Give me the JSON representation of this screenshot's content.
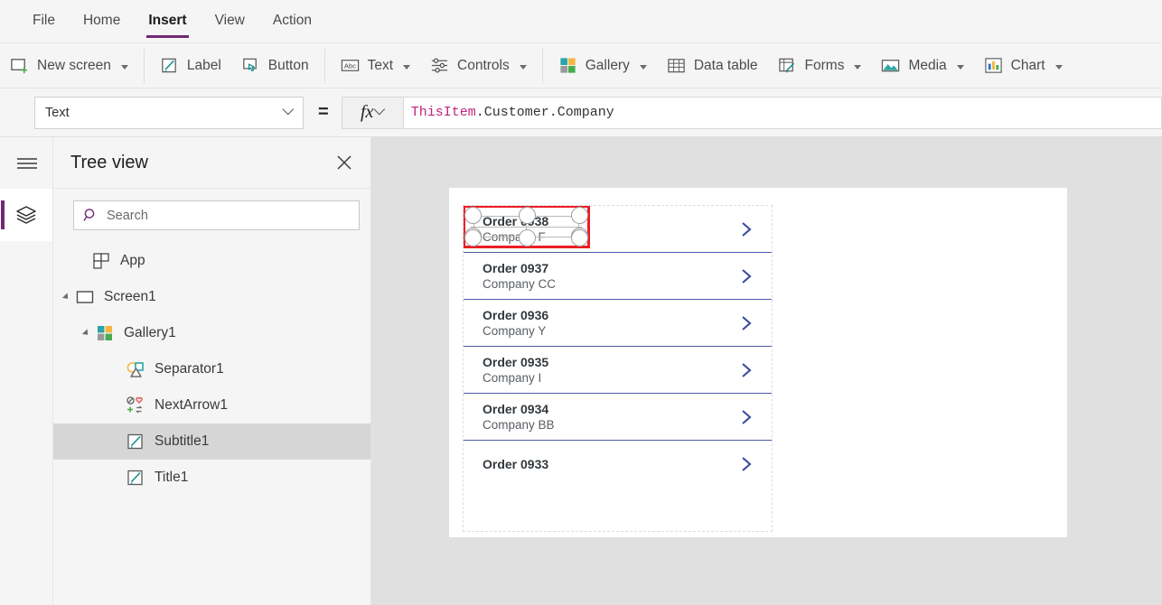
{
  "menubar": {
    "items": [
      {
        "label": "File",
        "active": false
      },
      {
        "label": "Home",
        "active": false
      },
      {
        "label": "Insert",
        "active": true
      },
      {
        "label": "View",
        "active": false
      },
      {
        "label": "Action",
        "active": false
      }
    ],
    "accent_color": "#742774"
  },
  "ribbon": {
    "items": [
      {
        "label": "New screen",
        "icon": "new-screen-icon",
        "caret": true
      },
      {
        "label": "Label",
        "icon": "label-icon",
        "caret": false
      },
      {
        "label": "Button",
        "icon": "button-icon",
        "caret": false
      },
      {
        "label": "Text",
        "icon": "text-icon",
        "caret": true
      },
      {
        "label": "Controls",
        "icon": "controls-icon",
        "caret": true
      },
      {
        "label": "Gallery",
        "icon": "gallery-icon",
        "caret": true
      },
      {
        "label": "Data table",
        "icon": "data-table-icon",
        "caret": false
      },
      {
        "label": "Forms",
        "icon": "forms-icon",
        "caret": true
      },
      {
        "label": "Media",
        "icon": "media-icon",
        "caret": true
      },
      {
        "label": "Chart",
        "icon": "chart-icon",
        "caret": true
      }
    ]
  },
  "formula_bar": {
    "property": "Text",
    "equals": "=",
    "fx_label": "fx",
    "formula_token_object": "ThisItem",
    "formula_token_rest": ".Customer.Company",
    "formula_full": "ThisItem.Customer.Company"
  },
  "tree_view": {
    "title": "Tree view",
    "close_icon": "close-icon",
    "search": {
      "placeholder": "Search",
      "value": "",
      "icon": "search-icon"
    },
    "items": [
      {
        "label": "App",
        "icon": "app-icon",
        "indent": 0,
        "expander": "none",
        "selected": false
      },
      {
        "label": "Screen1",
        "icon": "screen-icon",
        "indent": 0,
        "expander": "expanded",
        "selected": false
      },
      {
        "label": "Gallery1",
        "icon": "gallery-icon",
        "indent": 1,
        "expander": "expanded",
        "selected": false
      },
      {
        "label": "Separator1",
        "icon": "separator-icon",
        "indent": 2,
        "expander": "none",
        "selected": false
      },
      {
        "label": "NextArrow1",
        "icon": "nextarrow-icon",
        "indent": 2,
        "expander": "none",
        "selected": false
      },
      {
        "label": "Subtitle1",
        "icon": "label-edit-icon",
        "indent": 2,
        "expander": "none",
        "selected": true
      },
      {
        "label": "Title1",
        "icon": "label-edit-icon",
        "indent": 2,
        "expander": "none",
        "selected": false
      }
    ]
  },
  "canvas": {
    "background_color": "#ffffff",
    "stage_color": "#e0e0e0",
    "selection": {
      "control": "Subtitle1",
      "border_color": "#ee1c25",
      "handle_count": 8
    },
    "gallery": {
      "name": "Gallery1",
      "separator_color": "#4d5aa5",
      "chevron_color": "#3b4ba0",
      "rows": [
        {
          "title": "Order 0938",
          "subtitle": "Company F",
          "chevron": true,
          "selected": true
        },
        {
          "title": "Order 0937",
          "subtitle": "Company CC",
          "chevron": true,
          "selected": false
        },
        {
          "title": "Order 0936",
          "subtitle": "Company Y",
          "chevron": true,
          "selected": false
        },
        {
          "title": "Order 0935",
          "subtitle": "Company I",
          "chevron": true,
          "selected": false
        },
        {
          "title": "Order 0934",
          "subtitle": "Company BB",
          "chevron": true,
          "selected": false
        },
        {
          "title": "Order 0933",
          "subtitle": "",
          "chevron": true,
          "selected": false
        }
      ]
    }
  }
}
